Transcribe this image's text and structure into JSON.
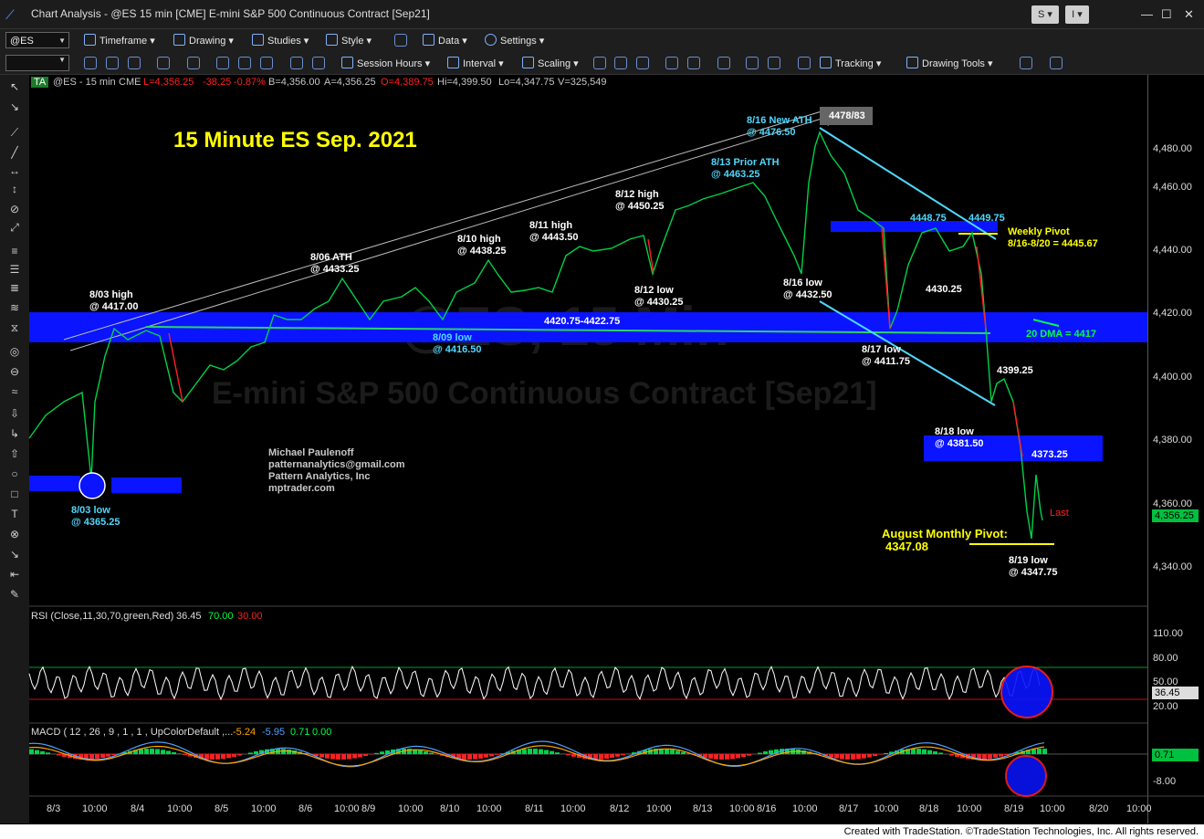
{
  "window": {
    "title": "Chart Analysis - @ES 15 min [CME] E-mini S&P 500 Continuous Contract [Sep21]",
    "btn_s": "S",
    "btn_i": "I"
  },
  "toolbar1": {
    "symbol": "@ES",
    "timeframe": "Timeframe",
    "drawing": "Drawing",
    "studies": "Studies",
    "style": "Style",
    "data": "Data",
    "settings": "Settings"
  },
  "toolbar2": {
    "session_hours": "Session Hours",
    "interval": "Interval",
    "scaling": "Scaling",
    "tracking": "Tracking",
    "drawing_tools": "Drawing Tools"
  },
  "infobar": {
    "ta": "TA",
    "symbol_label": "@ES - 15 min",
    "exchange": "CME",
    "last": "L=4,356.25",
    "chg": "-38.25",
    "chg_pct": "-0.87%",
    "bid": "B=4,356.00",
    "ask": "A=4,356.25",
    "open": "O=4,389.75",
    "high": "Hi=4,399.50",
    "low": "Lo=4,347.75",
    "volume": "V=325,549"
  },
  "chart": {
    "title": "15 Minute ES Sep. 2021",
    "watermark_big": "@ES, 15 Min",
    "watermark_sub": "E-mini S&P 500 Continuous Contract [Sep21]",
    "author": [
      "Michael Paulenoff",
      "patternanalytics@gmail.com",
      "Pattern Analytics, Inc",
      "mptrader.com"
    ],
    "price_ticks": [
      "4,480.00",
      "4,460.00",
      "4,440.00",
      "4,420.00",
      "4,400.00",
      "4,380.00",
      "4,360.00",
      "4,340.00"
    ],
    "last_price_tag": "4,356.25",
    "last_label": "Last",
    "x_ticks": [
      "8/3",
      "10:00",
      "8/4",
      "10:00",
      "8/5",
      "10:00",
      "8/6",
      "10:00",
      "8/9",
      "10:00",
      "8/10",
      "10:00",
      "8/11",
      "10:00",
      "8/12",
      "10:00",
      "8/13",
      "10:00",
      "8/16",
      "10:00",
      "8/17",
      "10:00",
      "8/18",
      "10:00",
      "8/19",
      "10:00",
      "8/20",
      "10:00"
    ],
    "annotations": {
      "a1": [
        "8/03 high",
        "@ 4417.00"
      ],
      "a2": [
        "8/03 low",
        "@ 4365.25"
      ],
      "a3": [
        "8/06 ATH",
        "@ 4433.25"
      ],
      "a4": [
        "8/09 low",
        "@ 4416.50"
      ],
      "a5": [
        "8/10 high",
        "@ 4438.25"
      ],
      "a6": [
        "8/11 high",
        "@ 4443.50"
      ],
      "a7": [
        "8/12 high",
        "@ 4450.25"
      ],
      "a8": [
        "8/12 low",
        "@ 4430.25"
      ],
      "a9": [
        "8/13 Prior ATH",
        "@ 4463.25"
      ],
      "a10": [
        "8/16 New ATH",
        "@ 4476.50"
      ],
      "a11": "4478/83",
      "a12": [
        "8/16 low",
        "@ 4432.50"
      ],
      "a13": "4448.75",
      "a14": "4449.75",
      "a15": [
        "Weekly Pivot",
        "8/16-8/20 = 4445.67"
      ],
      "a16": "4430.25",
      "a17": "4420.75-4422.75",
      "a18": "20 DMA = 4417",
      "a19": [
        "8/17 low",
        "@ 4411.75"
      ],
      "a20": "4399.25",
      "a21": [
        "8/18 low",
        "@ 4381.50"
      ],
      "a22": "4373.25",
      "a23": [
        "August Monthly Pivot:",
        "4347.08"
      ],
      "a24": [
        "8/19 low",
        "@ 4347.75"
      ]
    }
  },
  "rsi": {
    "label": "RSI (Close,11,30,70,green,Red)",
    "value": "36.45",
    "ob": "70.00",
    "os": "30.00",
    "ticks": [
      "110.00",
      "80.00",
      "50.00",
      "20.00"
    ],
    "tag": "36.45"
  },
  "macd": {
    "label": "MACD ( 12 , 26 , 9 , 1 , 1 , UpColorDefault ,...",
    "v1": "-5.24",
    "v2": "-5.95",
    "v3": "0.71",
    "v4": "0.00",
    "ticks": [
      "-8.00"
    ],
    "tag": "0.71"
  },
  "footer": "Created with TradeStation. ©TradeStation Technologies, Inc. All rights reserved.",
  "colors": {
    "zone": "#0000ff",
    "cyan": "#4fd8ff",
    "yellow": "#ffff00",
    "green": "#00ff44",
    "red": "#ff2020"
  }
}
